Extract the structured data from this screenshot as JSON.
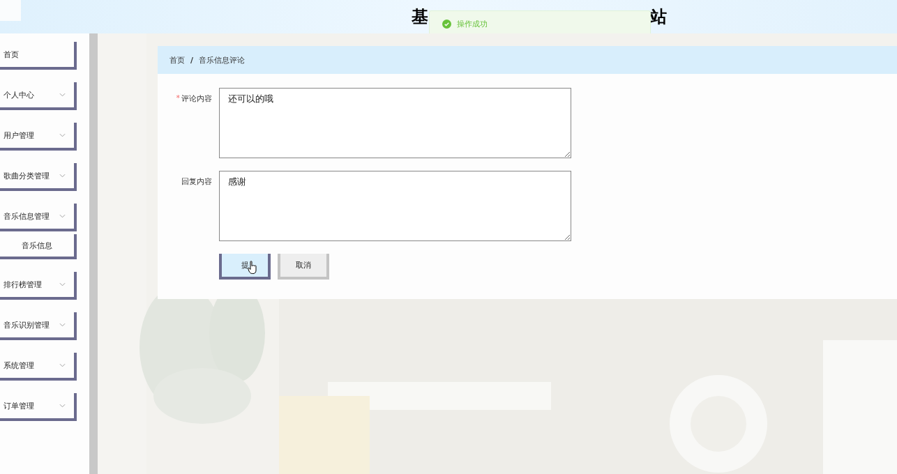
{
  "header": {
    "title_start": "基",
    "title_end": "站"
  },
  "toast": {
    "kind": "success",
    "text": "操作成功"
  },
  "sidebar": {
    "items": [
      {
        "label": "首页",
        "kind": "link"
      },
      {
        "label": "个人中心",
        "kind": "submenu"
      },
      {
        "label": "用户管理",
        "kind": "submenu"
      },
      {
        "label": "歌曲分类管理",
        "kind": "submenu"
      },
      {
        "label": "音乐信息管理",
        "kind": "submenu",
        "children": [
          {
            "label": "音乐信息"
          }
        ]
      },
      {
        "label": "排行榜管理",
        "kind": "submenu"
      },
      {
        "label": "音乐识别管理",
        "kind": "submenu"
      },
      {
        "label": "系统管理",
        "kind": "submenu"
      },
      {
        "label": "订单管理",
        "kind": "submenu"
      }
    ]
  },
  "breadcrumb": [
    "首页",
    "音乐信息评论"
  ],
  "breadcrumb_separator": "/",
  "form": {
    "required_mark": "*",
    "fields": [
      {
        "label": "评论内容",
        "required": true,
        "value": "还可以的哦"
      },
      {
        "label": "回复内容",
        "required": false,
        "value": "感谢"
      }
    ],
    "buttons": [
      {
        "label": "提",
        "kind": "primary"
      },
      {
        "label": "取消",
        "kind": "default"
      }
    ]
  }
}
